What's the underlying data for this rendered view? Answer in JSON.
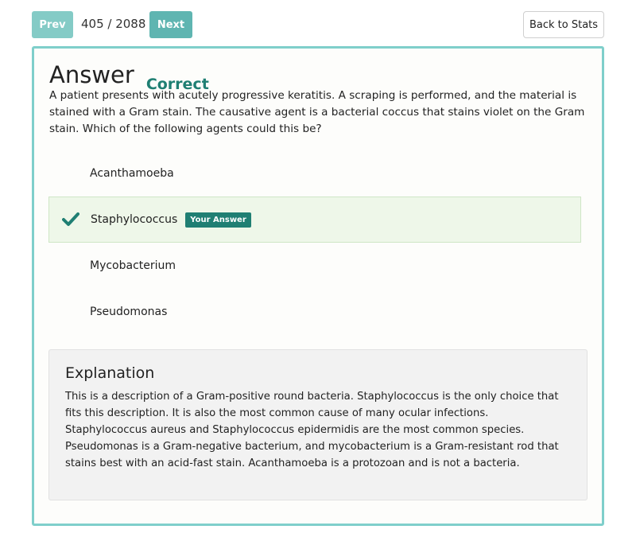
{
  "nav": {
    "prev_label": "Prev",
    "counter": "405 / 2088",
    "next_label": "Next",
    "back_label": "Back to Stats"
  },
  "answer": {
    "title": "Answer",
    "status": "Correct",
    "status_color": "#1f7f73"
  },
  "question": "A patient presents with acutely progressive keratitis. A scraping is performed, and the material is stained with a Gram stain. The causative agent is a bacterial coccus that stains violet on the Gram stain. Which of the following agents could this be?",
  "choices": [
    {
      "label": "Acanthamoeba"
    },
    {
      "label": "Staphylococcus",
      "badge": "Your Answer",
      "icon": "check-icon"
    },
    {
      "label": "Mycobacterium"
    },
    {
      "label": "Pseudomonas"
    }
  ],
  "explanation": {
    "title": "Explanation",
    "body": "This is a description of a Gram-positive round bacteria. Staphylococcus is the only choice that fits this description. It is also the most common cause of many ocular infections. Staphylococcus aureus and Staphylococcus epidermidis are the most common species. Pseudomonas is a Gram-negative bacterium, and mycobacterium is a Gram-resistant rod that stains best with an acid-fast stain. Acanthamoeba is a protozoan and is not a bacteria."
  },
  "colors": {
    "accent": "#6fc2bd",
    "card_border": "#7fcfcb",
    "selected_bg": "#eef7e9"
  }
}
